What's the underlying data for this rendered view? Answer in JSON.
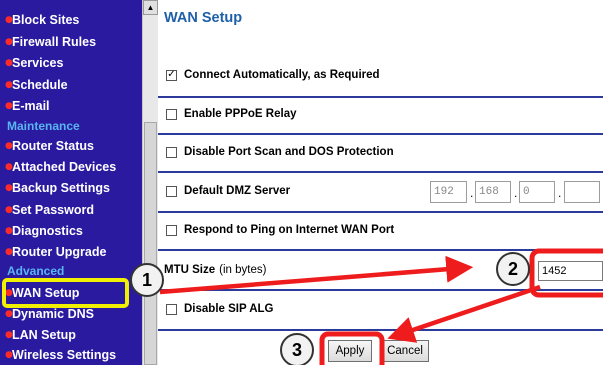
{
  "sidebar": {
    "items_top": [
      {
        "label": "Block Sites"
      },
      {
        "label": "Firewall Rules"
      },
      {
        "label": "Services"
      },
      {
        "label": "Schedule"
      },
      {
        "label": "E-mail"
      }
    ],
    "section_maintenance": "Maintenance",
    "items_maintenance": [
      {
        "label": "Router Status"
      },
      {
        "label": "Attached Devices"
      },
      {
        "label": "Backup Settings"
      },
      {
        "label": "Set Password"
      },
      {
        "label": "Diagnostics"
      },
      {
        "label": "Router Upgrade"
      }
    ],
    "section_advanced": "Advanced",
    "items_advanced": [
      {
        "label": "WAN Setup"
      },
      {
        "label": "Dynamic DNS"
      },
      {
        "label": "LAN Setup"
      },
      {
        "label": "Wireless Settings"
      }
    ],
    "bullet": "●"
  },
  "main": {
    "title": "WAN Setup",
    "connect_auto": {
      "label": "Connect Automatically, as Required",
      "checked": true,
      "mark": "✓"
    },
    "pppoe_relay": {
      "label": "Enable PPPoE Relay",
      "checked": false
    },
    "disable_port_scan": {
      "label": "Disable Port Scan and DOS Protection",
      "checked": false
    },
    "dmz": {
      "label": "Default DMZ Server",
      "checked": false,
      "ip": [
        "192",
        "168",
        "0",
        ""
      ]
    },
    "respond_ping": {
      "label": "Respond to Ping on Internet WAN Port",
      "checked": false
    },
    "mtu": {
      "label": "MTU Size",
      "unit": "(in bytes)",
      "value": "1452"
    },
    "sip_alg": {
      "label": "Disable SIP ALG",
      "checked": false
    },
    "apply_label": "Apply",
    "cancel_label": "Cancel"
  },
  "annotations": {
    "callouts": [
      "1",
      "2",
      "3"
    ],
    "highlight_color": "#f0f000",
    "arrow_color": "#ee1c1c"
  }
}
